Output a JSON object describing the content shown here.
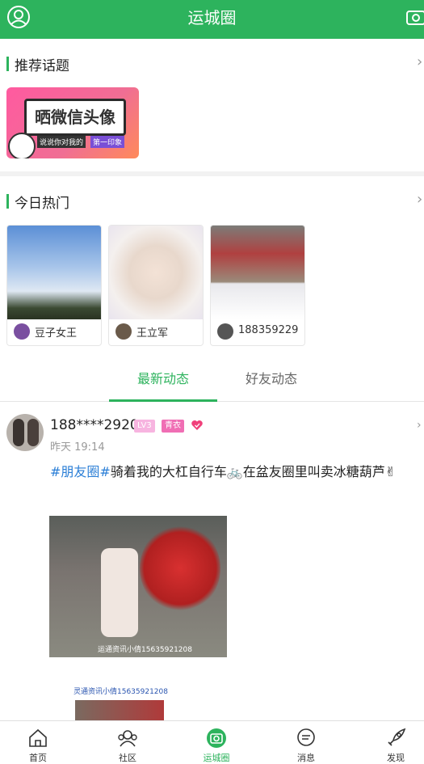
{
  "header": {
    "title": "运城圈",
    "user_icon": "user-circle-icon",
    "camera_icon": "camera-icon",
    "bg_color": "#2db35d"
  },
  "recommended": {
    "title": "推荐话题",
    "arrow": "›",
    "banner": {
      "text": "晒微信头像",
      "sub1": "说说你对我的",
      "sub2": "第一印象"
    }
  },
  "hot_today": {
    "title": "今日热门",
    "arrow": "›",
    "cards": [
      {
        "name": "豆子女王"
      },
      {
        "name": "王立军"
      },
      {
        "name": "188359229"
      }
    ]
  },
  "tabs": [
    {
      "label": "最新动态",
      "active": true
    },
    {
      "label": "好友动态",
      "active": false
    }
  ],
  "post": {
    "username": "188****2920",
    "level_badge": "LV3",
    "rank_badge": "青衣",
    "time": "昨天 19:14",
    "hashtag": "#朋友圈#",
    "text": "骑着我的大杠自行车🚲在盆友圈里叫卖冰糖葫芦✌",
    "photo_overlay": "运通资讯小倩15635921208",
    "photo_caption": "灵通资讯小倩15635921208",
    "more": "›"
  },
  "bottom_nav": [
    {
      "label": "首页",
      "icon": "home-icon",
      "active": false
    },
    {
      "label": "社区",
      "icon": "community-icon",
      "active": false
    },
    {
      "label": "运城圈",
      "icon": "circle-camera-icon",
      "active": true
    },
    {
      "label": "消息",
      "icon": "message-icon",
      "active": false
    },
    {
      "label": "发现",
      "icon": "rocket-icon",
      "active": false
    }
  ],
  "colors": {
    "accent": "#2db35d",
    "tag": "#2a7ed6",
    "badge_level": "#f5a0d6",
    "badge_rank": "#f06eb4"
  }
}
